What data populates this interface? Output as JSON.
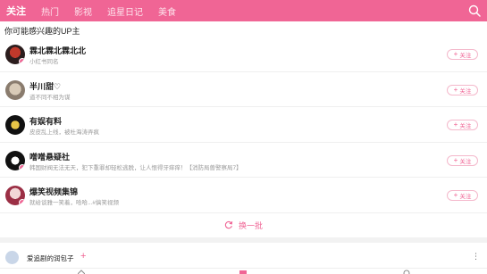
{
  "topbar": {
    "tabs": [
      "关注",
      "热门",
      "影视",
      "追星日记",
      "美食"
    ],
    "active_color": "#ffffff",
    "bg_color": "#f06595"
  },
  "recommend": {
    "heading": "你可能感兴趣的UP主",
    "follow_label": "关注",
    "items": [
      {
        "name": "霖北霖北霖北北",
        "desc": "小红书同名"
      },
      {
        "name": "半川甜♡",
        "desc": "道不同不相为谋"
      },
      {
        "name": "有娱有料",
        "desc": "皮皮乱上线，被杜海涛弄疯"
      },
      {
        "name": "噌噌悬疑社",
        "desc": "韩国财阀无法无天，犯下重罪却轻松逃脱，让人恨得牙痒痒！【消防局兽警察局7】"
      },
      {
        "name": "爆笑视频集锦",
        "desc": "就给谈雅一笑着，哈哈...#搞笑视频"
      }
    ],
    "refresh_label": "换一批"
  },
  "post": {
    "author": "爱追剧的润包子",
    "plus": "+",
    "more": "⋮"
  }
}
